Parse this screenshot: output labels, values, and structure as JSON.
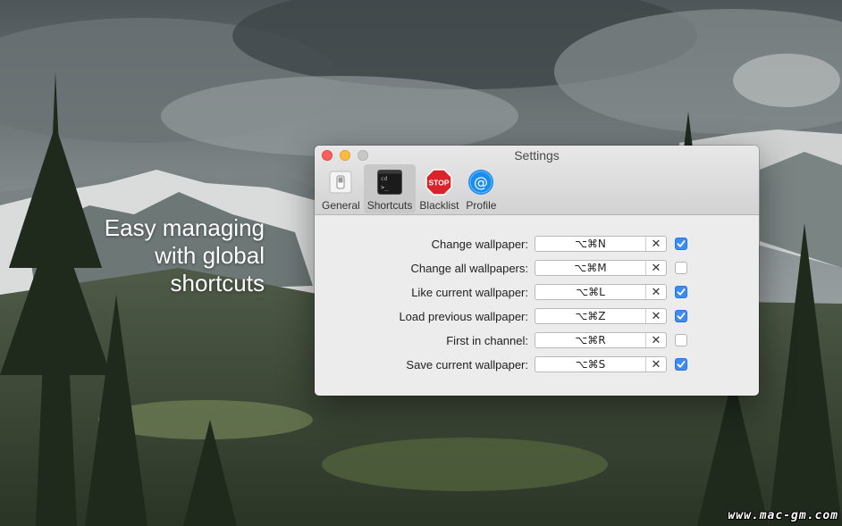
{
  "promo": {
    "lines": [
      "Easy managing",
      "with global",
      "shortcuts"
    ]
  },
  "watermark": "www.mac-gm.com",
  "window": {
    "title": "Settings",
    "tabs": [
      {
        "label": "General",
        "icon": "switch-icon",
        "active": false
      },
      {
        "label": "Shortcuts",
        "icon": "terminal-icon",
        "active": true
      },
      {
        "label": "Blacklist",
        "icon": "stop-sign-icon",
        "active": false
      },
      {
        "label": "Profile",
        "icon": "at-sign-icon",
        "active": false
      }
    ],
    "stop_text": "STOP",
    "shortcuts": [
      {
        "label": "Change wallpaper:",
        "keys": "⌥⌘N",
        "enabled": true
      },
      {
        "label": "Change all wallpapers:",
        "keys": "⌥⌘M",
        "enabled": false
      },
      {
        "label": "Like current wallpaper:",
        "keys": "⌥⌘L",
        "enabled": true
      },
      {
        "label": "Load previous wallpaper:",
        "keys": "⌥⌘Z",
        "enabled": true
      },
      {
        "label": "First in channel:",
        "keys": "⌥⌘R",
        "enabled": false
      },
      {
        "label": "Save current wallpaper:",
        "keys": "⌥⌘S",
        "enabled": true
      }
    ],
    "clear_glyph": "✕"
  },
  "colors": {
    "accent": "#3b8cf5",
    "close": "#fc605c",
    "minimize": "#fdbc40",
    "stop": "#d8232a"
  }
}
